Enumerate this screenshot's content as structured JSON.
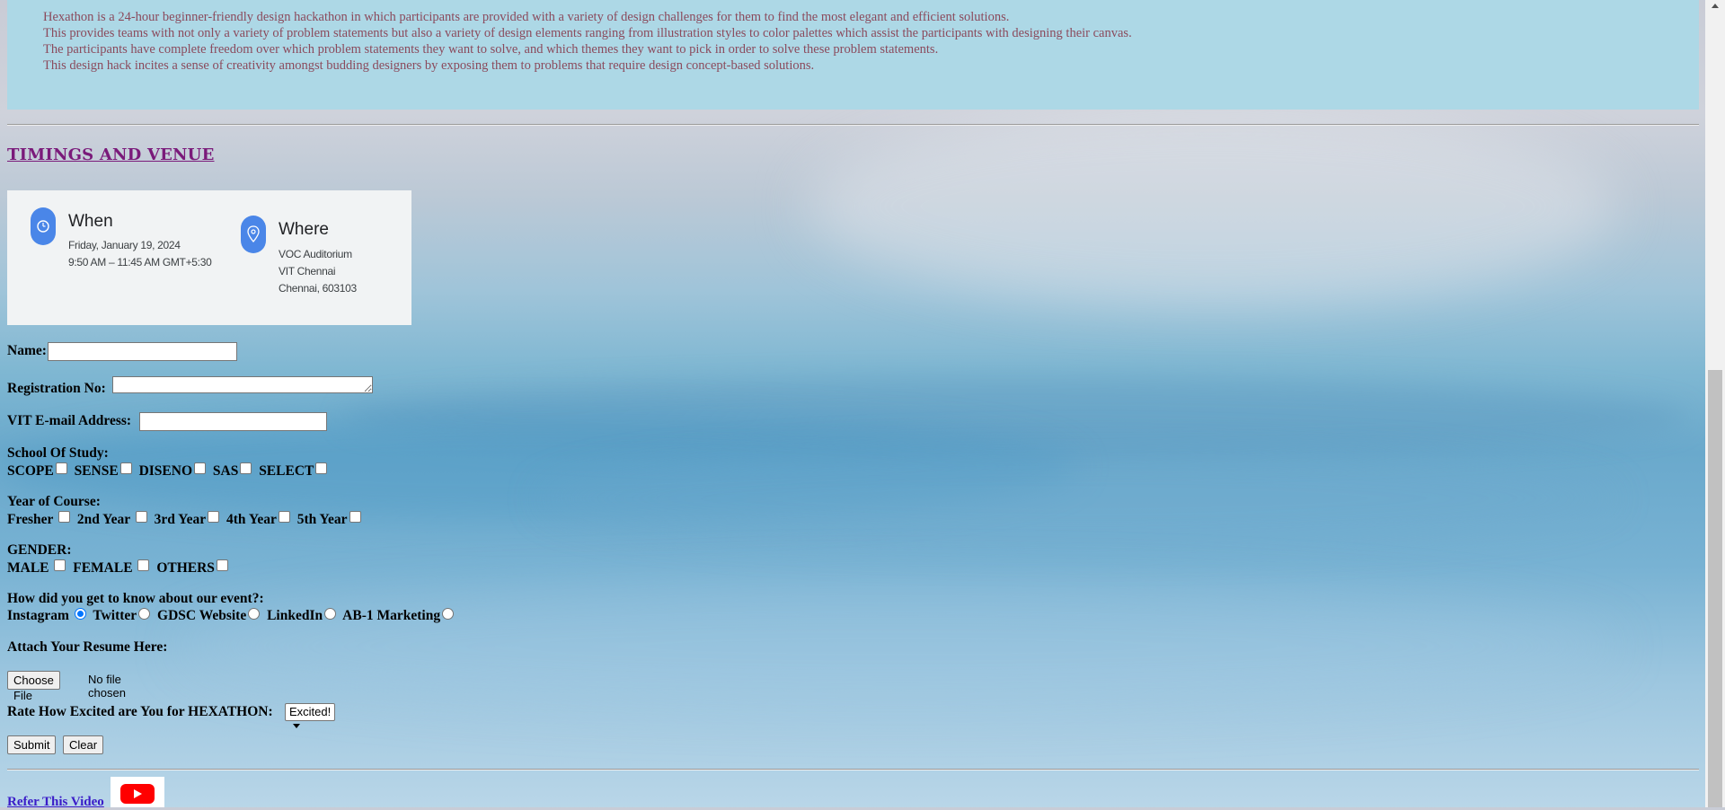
{
  "about": {
    "lines": [
      "Hexathon is a 24-hour beginner-friendly design hackathon in which participants are provided with a variety of design challenges for them to find the most elegant and efficient solutions.",
      "This provides teams with not only a variety of problem statements but also a variety of design elements ranging from illustration styles to color palettes which assist the participants with designing their canvas.",
      "The participants have complete freedom over which problem statements they want to solve, and which themes they want to pick in order to solve these problem statements.",
      "This design hack incites a sense of creativity amongst budding designers by exposing them to problems that require design concept-based solutions."
    ]
  },
  "section_title": "TIMINGS AND VENUE",
  "venue_card": {
    "when_heading": "When",
    "when_date": "Friday, January 19, 2024",
    "when_time": "9:50 AM – 11:45 AM GMT+5:30",
    "where_heading": "Where",
    "where_line1": "VOC Auditorium",
    "where_line2": "VIT Chennai",
    "where_line3": "Chennai, 603103"
  },
  "form": {
    "name_label": "Name:",
    "reg_label": "Registration No:",
    "email_label": "VIT E-mail Address:",
    "school_label": "School Of Study:",
    "school_options": [
      "SCOPE",
      "SENSE",
      "DISENO",
      "SAS",
      "SELECT"
    ],
    "year_label": "Year of Course:",
    "year_options": [
      "Fresher",
      "2nd Year",
      "3rd Year",
      "4th Year",
      "5th Year"
    ],
    "gender_label": "GENDER:",
    "gender_options": [
      "MALE",
      "FEMALE",
      "OTHERS"
    ],
    "source_label": "How did you get to know about our event?:",
    "source_options": [
      "Instagram",
      "Twitter",
      "GDSC Website",
      "LinkedIn",
      "AB-1 Marketing"
    ],
    "source_selected": "Instagram",
    "resume_label": "Attach Your Resume Here:",
    "choose_file": "Choose File",
    "no_file": "No file chosen",
    "rate_label": "Rate How Excited are You for HEXATHON:",
    "rate_value": "Excited!",
    "submit": "Submit",
    "clear": "Clear"
  },
  "video_link": "Refer This Video",
  "colors": {
    "about_bg": "#add8e6",
    "about_text": "#8b4a5c",
    "title": "#7a1a7a",
    "link": "#3a1cc8",
    "pin": "#4a86e8",
    "radio_accent": "#0075ff"
  },
  "icons": [
    "clock-icon",
    "location-pin-icon",
    "youtube-icon",
    "chevron-down-icon",
    "scroll-up-arrow-icon"
  ]
}
